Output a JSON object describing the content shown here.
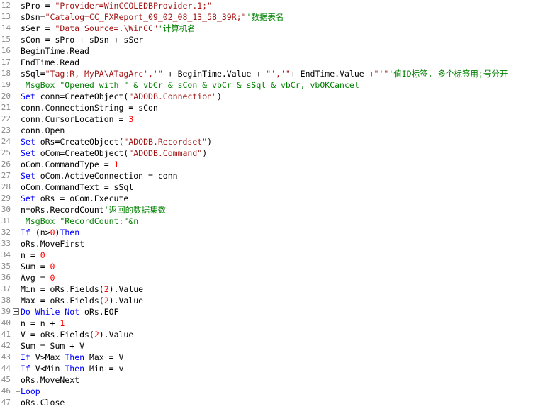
{
  "editor": {
    "lines": [
      {
        "num": "12",
        "fold": "",
        "tokens": [
          {
            "c": "t",
            "v": "sPro = "
          },
          {
            "c": "str",
            "v": "\"Provider=WinCCOLEDBProvider.1;\""
          }
        ]
      },
      {
        "num": "13",
        "fold": "",
        "tokens": [
          {
            "c": "t",
            "v": "sDsn="
          },
          {
            "c": "str",
            "v": "\"Catalog=CC_FXReport_09_02_08_13_58_39R;\""
          },
          {
            "c": "cmt",
            "v": "'数据表名"
          }
        ]
      },
      {
        "num": "14",
        "fold": "",
        "tokens": [
          {
            "c": "t",
            "v": "sSer = "
          },
          {
            "c": "str",
            "v": "\"Data Source=.\\WinCC\""
          },
          {
            "c": "cmt",
            "v": "'计算机名"
          }
        ]
      },
      {
        "num": "15",
        "fold": "",
        "tokens": [
          {
            "c": "t",
            "v": "sCon = sPro + sDsn + sSer"
          }
        ]
      },
      {
        "num": "16",
        "fold": "",
        "tokens": [
          {
            "c": "t",
            "v": "BeginTime.Read"
          }
        ]
      },
      {
        "num": "17",
        "fold": "",
        "tokens": [
          {
            "c": "t",
            "v": "EndTime.Read"
          }
        ]
      },
      {
        "num": "18",
        "fold": "",
        "tokens": [
          {
            "c": "t",
            "v": "sSql="
          },
          {
            "c": "str",
            "v": "\"Tag:R,'MyPA\\ATagArc','\""
          },
          {
            "c": "t",
            "v": " + BeginTime.Value + "
          },
          {
            "c": "str",
            "v": "\"','\""
          },
          {
            "c": "t",
            "v": "+ EndTime.Value +"
          },
          {
            "c": "str",
            "v": "\"'\""
          },
          {
            "c": "cmt",
            "v": "'值ID标签, 多个标签用;号分开"
          }
        ]
      },
      {
        "num": "19",
        "fold": "",
        "tokens": [
          {
            "c": "cmt",
            "v": "'MsgBox \"Opened with \" & vbCr & sCon & vbCr & sSql & vbCr, vbOKCancel"
          }
        ]
      },
      {
        "num": "20",
        "fold": "",
        "tokens": [
          {
            "c": "kw",
            "v": "Set"
          },
          {
            "c": "t",
            "v": " conn=CreateObject("
          },
          {
            "c": "str",
            "v": "\"ADODB.Connection\""
          },
          {
            "c": "t",
            "v": ")"
          }
        ]
      },
      {
        "num": "21",
        "fold": "",
        "tokens": [
          {
            "c": "t",
            "v": "conn.ConnectionString = sCon"
          }
        ]
      },
      {
        "num": "22",
        "fold": "",
        "tokens": [
          {
            "c": "t",
            "v": "conn.CursorLocation = "
          },
          {
            "c": "num",
            "v": "3"
          }
        ]
      },
      {
        "num": "23",
        "fold": "",
        "tokens": [
          {
            "c": "t",
            "v": "conn.Open"
          }
        ]
      },
      {
        "num": "24",
        "fold": "",
        "tokens": [
          {
            "c": "kw",
            "v": "Set"
          },
          {
            "c": "t",
            "v": " oRs=CreateObject("
          },
          {
            "c": "str",
            "v": "\"ADODB.Recordset\""
          },
          {
            "c": "t",
            "v": ")"
          }
        ]
      },
      {
        "num": "25",
        "fold": "",
        "tokens": [
          {
            "c": "kw",
            "v": "Set"
          },
          {
            "c": "t",
            "v": " oCom=CreateObject("
          },
          {
            "c": "str",
            "v": "\"ADODB.Command\""
          },
          {
            "c": "t",
            "v": ")"
          }
        ]
      },
      {
        "num": "26",
        "fold": "",
        "tokens": [
          {
            "c": "t",
            "v": "oCom.CommandType = "
          },
          {
            "c": "num",
            "v": "1"
          }
        ]
      },
      {
        "num": "27",
        "fold": "",
        "tokens": [
          {
            "c": "kw",
            "v": "Set"
          },
          {
            "c": "t",
            "v": " oCom.ActiveConnection = conn"
          }
        ]
      },
      {
        "num": "28",
        "fold": "",
        "tokens": [
          {
            "c": "t",
            "v": "oCom.CommandText = sSql"
          }
        ]
      },
      {
        "num": "29",
        "fold": "",
        "tokens": [
          {
            "c": "kw",
            "v": "Set"
          },
          {
            "c": "t",
            "v": " oRs = oCom.Execute"
          }
        ]
      },
      {
        "num": "30",
        "fold": "",
        "tokens": [
          {
            "c": "t",
            "v": "n=oRs.RecordCount"
          },
          {
            "c": "cmt",
            "v": "'返回的数据集数"
          }
        ]
      },
      {
        "num": "31",
        "fold": "",
        "tokens": [
          {
            "c": "cmt",
            "v": "'MsgBox \"RecordCount:\"&n"
          }
        ]
      },
      {
        "num": "32",
        "fold": "",
        "tokens": [
          {
            "c": "kw",
            "v": "If"
          },
          {
            "c": "t",
            "v": " (n>"
          },
          {
            "c": "num",
            "v": "0"
          },
          {
            "c": "t",
            "v": ")"
          },
          {
            "c": "kw",
            "v": "Then"
          }
        ]
      },
      {
        "num": "33",
        "fold": "",
        "tokens": [
          {
            "c": "t",
            "v": "oRs.MoveFirst"
          }
        ]
      },
      {
        "num": "34",
        "fold": "",
        "tokens": [
          {
            "c": "t",
            "v": "n = "
          },
          {
            "c": "num",
            "v": "0"
          }
        ]
      },
      {
        "num": "35",
        "fold": "",
        "tokens": [
          {
            "c": "t",
            "v": "Sum = "
          },
          {
            "c": "num",
            "v": "0"
          }
        ]
      },
      {
        "num": "36",
        "fold": "",
        "tokens": [
          {
            "c": "t",
            "v": "Avg = "
          },
          {
            "c": "num",
            "v": "0"
          }
        ]
      },
      {
        "num": "37",
        "fold": "",
        "tokens": [
          {
            "c": "t",
            "v": "Min = oRs.Fields("
          },
          {
            "c": "num",
            "v": "2"
          },
          {
            "c": "t",
            "v": ").Value"
          }
        ]
      },
      {
        "num": "38",
        "fold": "",
        "tokens": [
          {
            "c": "t",
            "v": "Max = oRs.Fields("
          },
          {
            "c": "num",
            "v": "2"
          },
          {
            "c": "t",
            "v": ").Value"
          }
        ]
      },
      {
        "num": "39",
        "fold": "start",
        "tokens": [
          {
            "c": "kw",
            "v": "Do While Not"
          },
          {
            "c": "t",
            "v": " oRs.EOF"
          }
        ]
      },
      {
        "num": "40",
        "fold": "line",
        "tokens": [
          {
            "c": "t",
            "v": "n = n + "
          },
          {
            "c": "num",
            "v": "1"
          }
        ]
      },
      {
        "num": "41",
        "fold": "line",
        "tokens": [
          {
            "c": "t",
            "v": "V = oRs.Fields("
          },
          {
            "c": "num",
            "v": "2"
          },
          {
            "c": "t",
            "v": ").Value"
          }
        ]
      },
      {
        "num": "42",
        "fold": "line",
        "tokens": [
          {
            "c": "t",
            "v": "Sum = Sum + V"
          }
        ]
      },
      {
        "num": "43",
        "fold": "line",
        "tokens": [
          {
            "c": "kw",
            "v": "If"
          },
          {
            "c": "t",
            "v": " V>Max "
          },
          {
            "c": "kw",
            "v": "Then"
          },
          {
            "c": "t",
            "v": " Max = V"
          }
        ]
      },
      {
        "num": "44",
        "fold": "line",
        "tokens": [
          {
            "c": "kw",
            "v": "If"
          },
          {
            "c": "t",
            "v": " V<Min "
          },
          {
            "c": "kw",
            "v": "Then"
          },
          {
            "c": "t",
            "v": " Min = v"
          }
        ]
      },
      {
        "num": "45",
        "fold": "line",
        "tokens": [
          {
            "c": "t",
            "v": "oRs.MoveNext"
          }
        ]
      },
      {
        "num": "46",
        "fold": "end",
        "tokens": [
          {
            "c": "kw",
            "v": "Loop"
          }
        ]
      },
      {
        "num": "47",
        "fold": "",
        "tokens": [
          {
            "c": "t",
            "v": "oRs.Close"
          }
        ]
      }
    ]
  },
  "colors": {
    "keyword": "#0000ff",
    "string": "#a31515",
    "number": "#ff0000",
    "comment": "#008000",
    "line_number": "#8a8a8a"
  }
}
